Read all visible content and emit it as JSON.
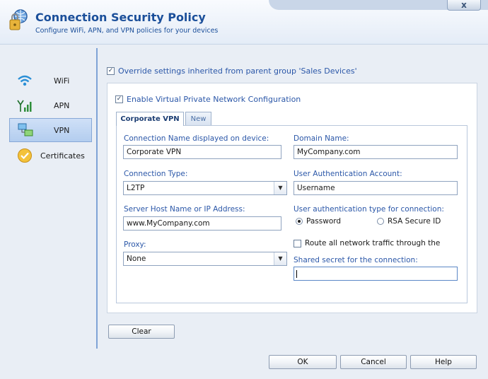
{
  "header": {
    "title": "Connection Security Policy",
    "subtitle": "Configure WiFi, APN, and VPN policies for your devices",
    "close_icon": "close-icon",
    "close_label": "x"
  },
  "sidebar": {
    "items": [
      {
        "label": "WiFi",
        "icon": "wifi-icon"
      },
      {
        "label": "APN",
        "icon": "signal-icon"
      },
      {
        "label": "VPN",
        "icon": "network-icon",
        "selected": true
      },
      {
        "label": "Certificates",
        "icon": "certificate-icon"
      }
    ]
  },
  "override": {
    "label": "Override settings inherited from parent group 'Sales Devices'",
    "checked": true
  },
  "vpn": {
    "enable_label": "Enable Virtual Private Network Configuration",
    "enable_checked": true,
    "tabs": [
      {
        "label": "Corporate VPN",
        "active": true
      },
      {
        "label": "New",
        "active": false
      }
    ],
    "connection_name_label": "Connection Name displayed on device:",
    "connection_name_value": "Corporate VPN",
    "domain_name_label": "Domain Name:",
    "domain_name_value": "MyCompany.com",
    "connection_type_label": "Connection Type:",
    "connection_type_value": "L2TP",
    "user_auth_account_label": "User Authentication Account:",
    "user_auth_account_value": "Username",
    "server_host_label": "Server Host Name or IP Address:",
    "server_host_value": "www.MyCompany.com",
    "auth_type_label": "User authentication type for connection:",
    "auth_option_password": "Password",
    "auth_option_rsa": "RSA Secure ID",
    "auth_selected": "Password",
    "proxy_label": "Proxy:",
    "proxy_value": "None",
    "route_all_label": "Route all network traffic through the",
    "route_all_checked": false,
    "shared_secret_label": "Shared secret for the connection:",
    "shared_secret_value": ""
  },
  "buttons": {
    "clear": "Clear",
    "ok": "OK",
    "cancel": "Cancel",
    "help": "Help"
  },
  "colors": {
    "accent": "#2b57a8",
    "title": "#1b4f9a",
    "selected_nav": "#b3cdef"
  }
}
